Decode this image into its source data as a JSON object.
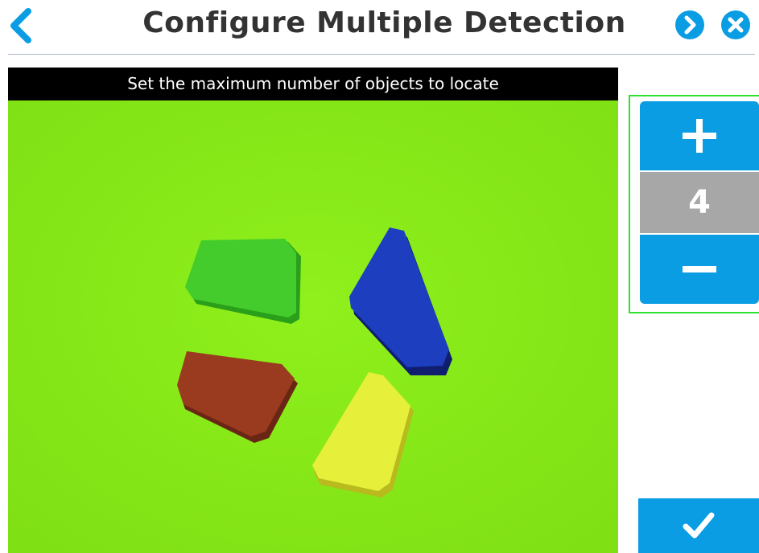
{
  "header": {
    "title": "Configure Multiple Detection",
    "back_icon": "chevron-left-icon",
    "next_icon": "play-icon",
    "close_icon": "close-icon"
  },
  "camera": {
    "instruction": "Set the maximum number of objects to locate",
    "objects": [
      "green trapezoid",
      "blue trapezoid",
      "red trapezoid",
      "yellow trapezoid"
    ]
  },
  "stepper": {
    "increment_icon": "plus-icon",
    "value": "4",
    "decrement_icon": "minus-icon"
  },
  "footer": {
    "confirm_icon": "checkmark-icon"
  },
  "colors": {
    "accent": "#0a9de3",
    "title_text": "#333333",
    "count_bg": "#a7a7a7",
    "highlight_border": "#2fe12f",
    "camera_background": "#88ea1a"
  }
}
